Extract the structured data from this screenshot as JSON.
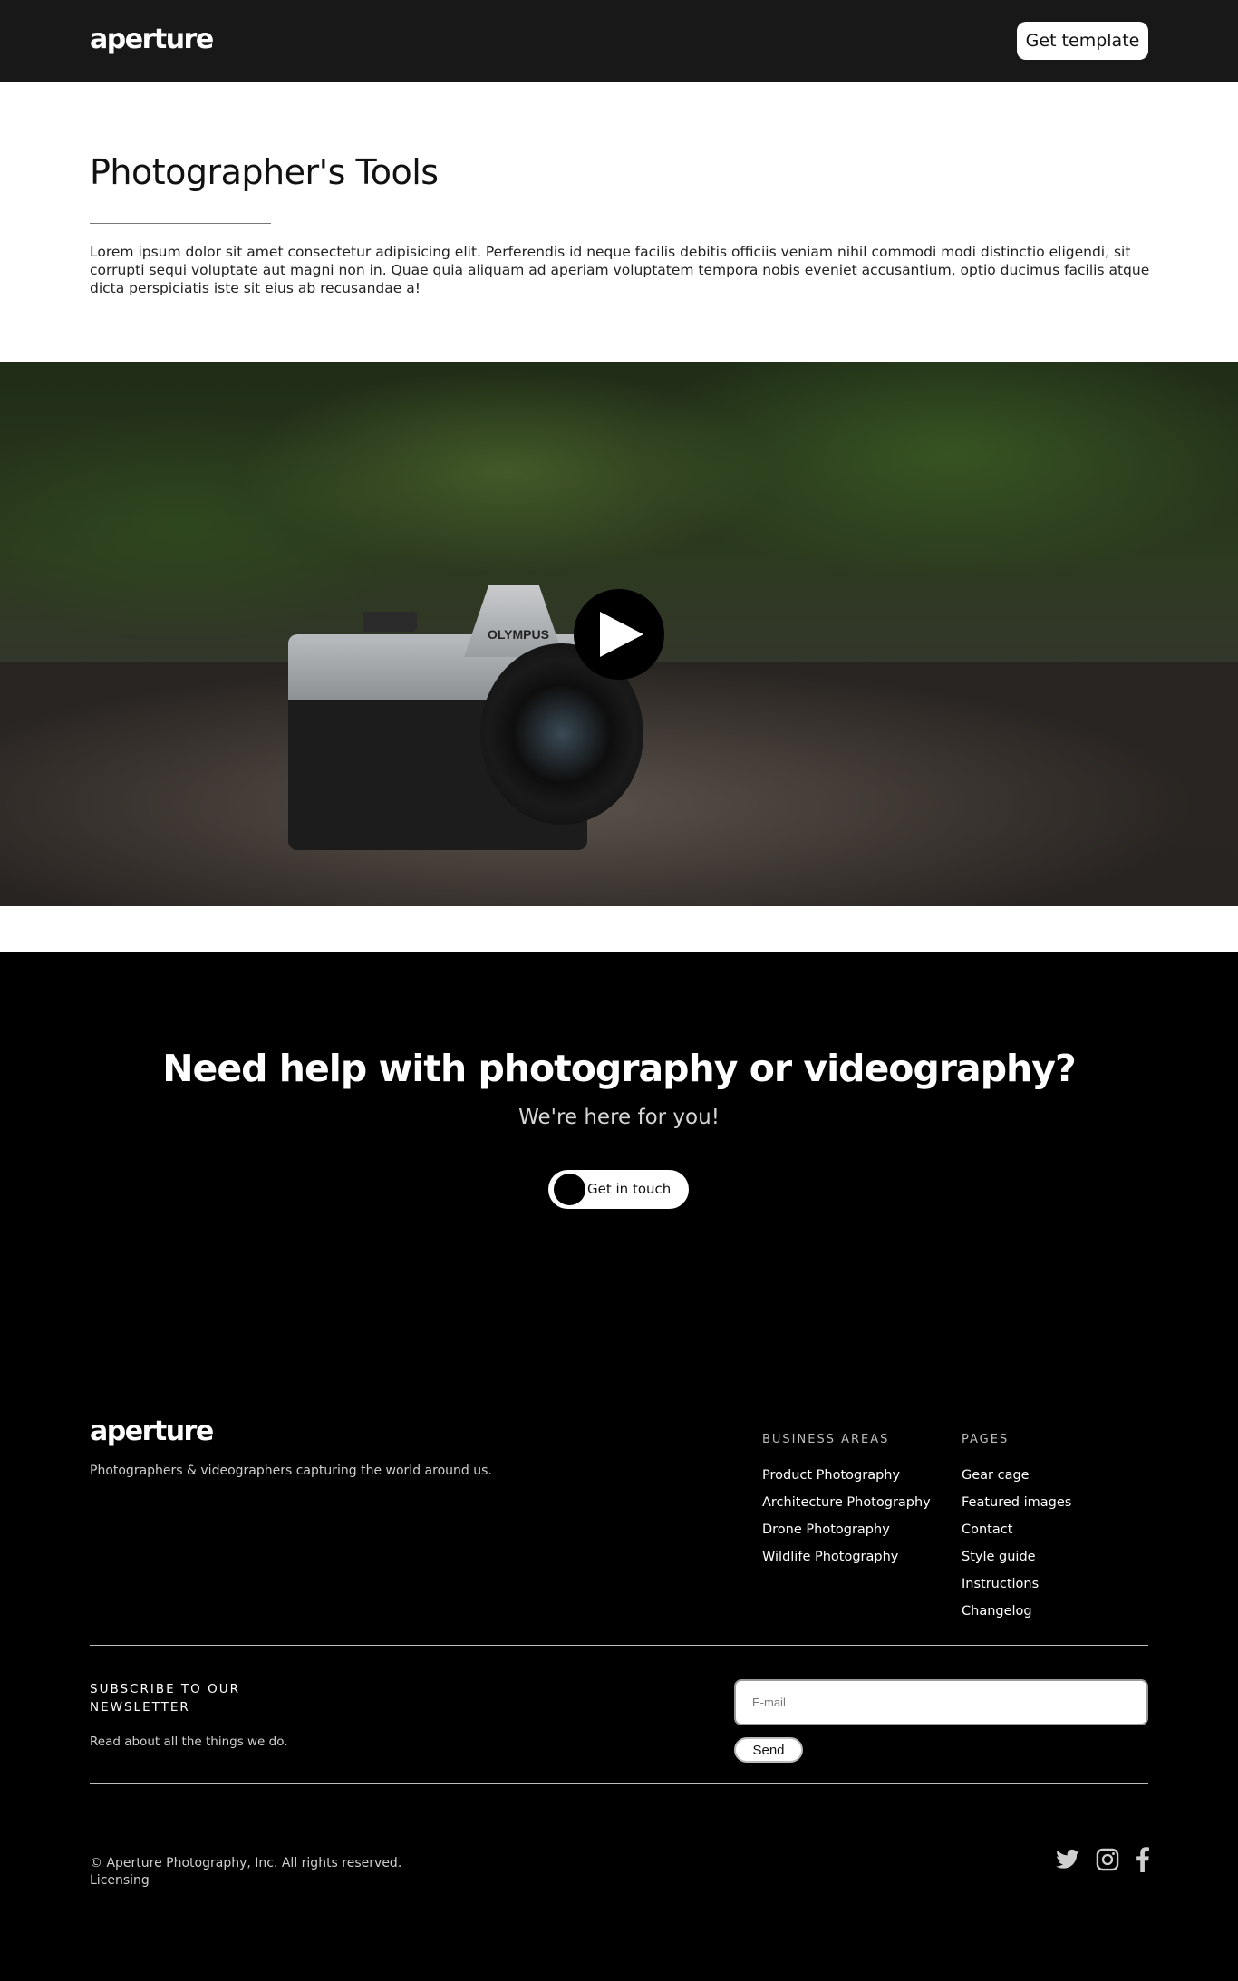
{
  "header": {
    "logo": "aperture",
    "get_template_label": "Get template"
  },
  "intro": {
    "title": "Photographer's Tools",
    "body": "Lorem ipsum dolor sit amet consectetur adipisicing elit. Perferendis id neque facilis debitis officiis veniam nihil commodi modi distinctio eligendi, sit corrupti sequi voluptate aut magni non in. Quae quia aliquam ad aperiam voluptatem tempora nobis eveniet accusantium, optio ducimus facilis atque dicta perspiciatis iste sit eius ab recusandae a!"
  },
  "hero": {
    "camera_brand": "OLYMPUS",
    "play_icon": "play-icon"
  },
  "cta": {
    "title": "Need help with photography or videography?",
    "subtitle": "We're here for you!",
    "button_label": "Get in touch"
  },
  "footer": {
    "logo": "aperture",
    "tagline": "Photographers & videographers capturing the world around us.",
    "business_areas": {
      "heading": "BUSINESS AREAS",
      "links": [
        "Product Photography",
        "Architecture Photography",
        "Drone Photography",
        "Wildlife Photography"
      ]
    },
    "pages": {
      "heading": "PAGES",
      "links": [
        "Gear cage",
        "Featured images",
        "Contact",
        "Style guide",
        "Instructions",
        "Changelog"
      ]
    },
    "newsletter": {
      "title": "SUBSCRIBE TO OUR NEWSLETTER",
      "description": "Read about all the things we do.",
      "email_placeholder": "E-mail",
      "send_label": "Send"
    },
    "copyright": "© Aperture Photography, Inc. All rights reserved.",
    "licensing": "Licensing",
    "social_icons": [
      "twitter-icon",
      "instagram-icon",
      "facebook-icon"
    ]
  },
  "colors": {
    "header_bg": "#181818",
    "footer_bg": "#000000",
    "text_light": "#cfcfcf"
  }
}
